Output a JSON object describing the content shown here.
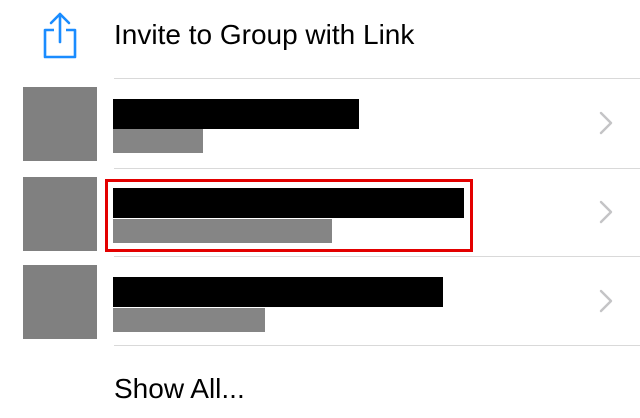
{
  "invite": {
    "label": "Invite to Group with Link",
    "icon": "share-icon",
    "icon_color": "#1a8cff"
  },
  "contacts": [
    {
      "name": "",
      "subtitle": "",
      "redacted": true
    },
    {
      "name": "",
      "subtitle": "",
      "redacted": true,
      "highlighted": true
    },
    {
      "name": "",
      "subtitle": "",
      "redacted": true
    }
  ],
  "show_all": {
    "label": "Show All..."
  },
  "colors": {
    "highlight": "#e30000",
    "divider": "#d9d9d9",
    "chevron": "#c4c4c6"
  }
}
